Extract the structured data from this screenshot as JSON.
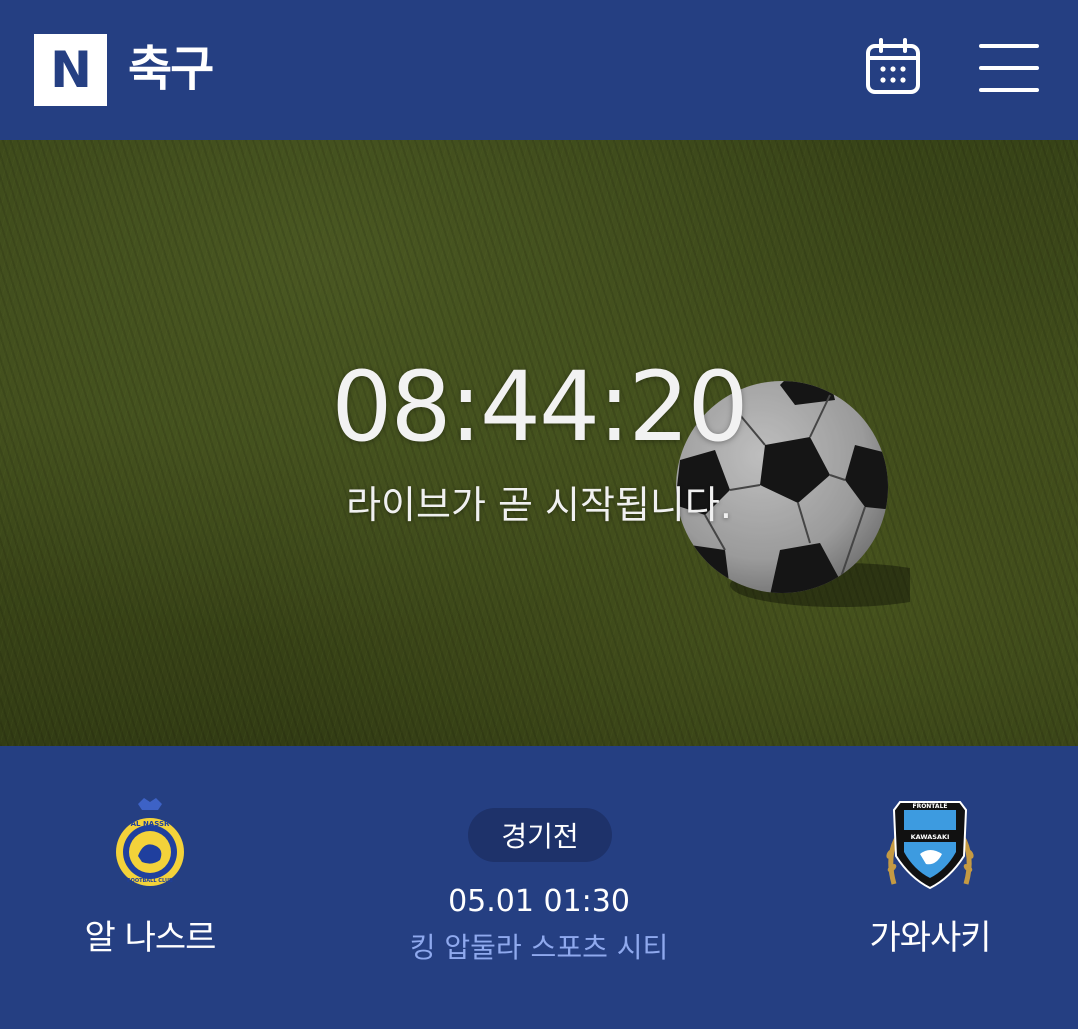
{
  "header": {
    "logo_letter": "N",
    "title": "축구",
    "calendar_icon": "calendar-icon",
    "menu_icon": "hamburger-menu-icon"
  },
  "hero": {
    "countdown": "08:44:20",
    "message": "라이브가 곧 시작됩니다."
  },
  "match": {
    "home_team": {
      "name": "알 나스르",
      "crest_text_top": "AL NASSR",
      "crest_text_bottom": "FOOTBALL CLUB"
    },
    "away_team": {
      "name": "가와사키",
      "crest_text_top": "FRONTALE",
      "crest_text_mid": "KAWASAKI"
    },
    "status": "경기전",
    "datetime": "05.01 01:30",
    "venue": "킹 압둘라 스포츠 시티"
  },
  "colors": {
    "brand_blue": "#253f82",
    "pill_bg": "#1e326a",
    "venue_text": "#8fa9ee"
  }
}
